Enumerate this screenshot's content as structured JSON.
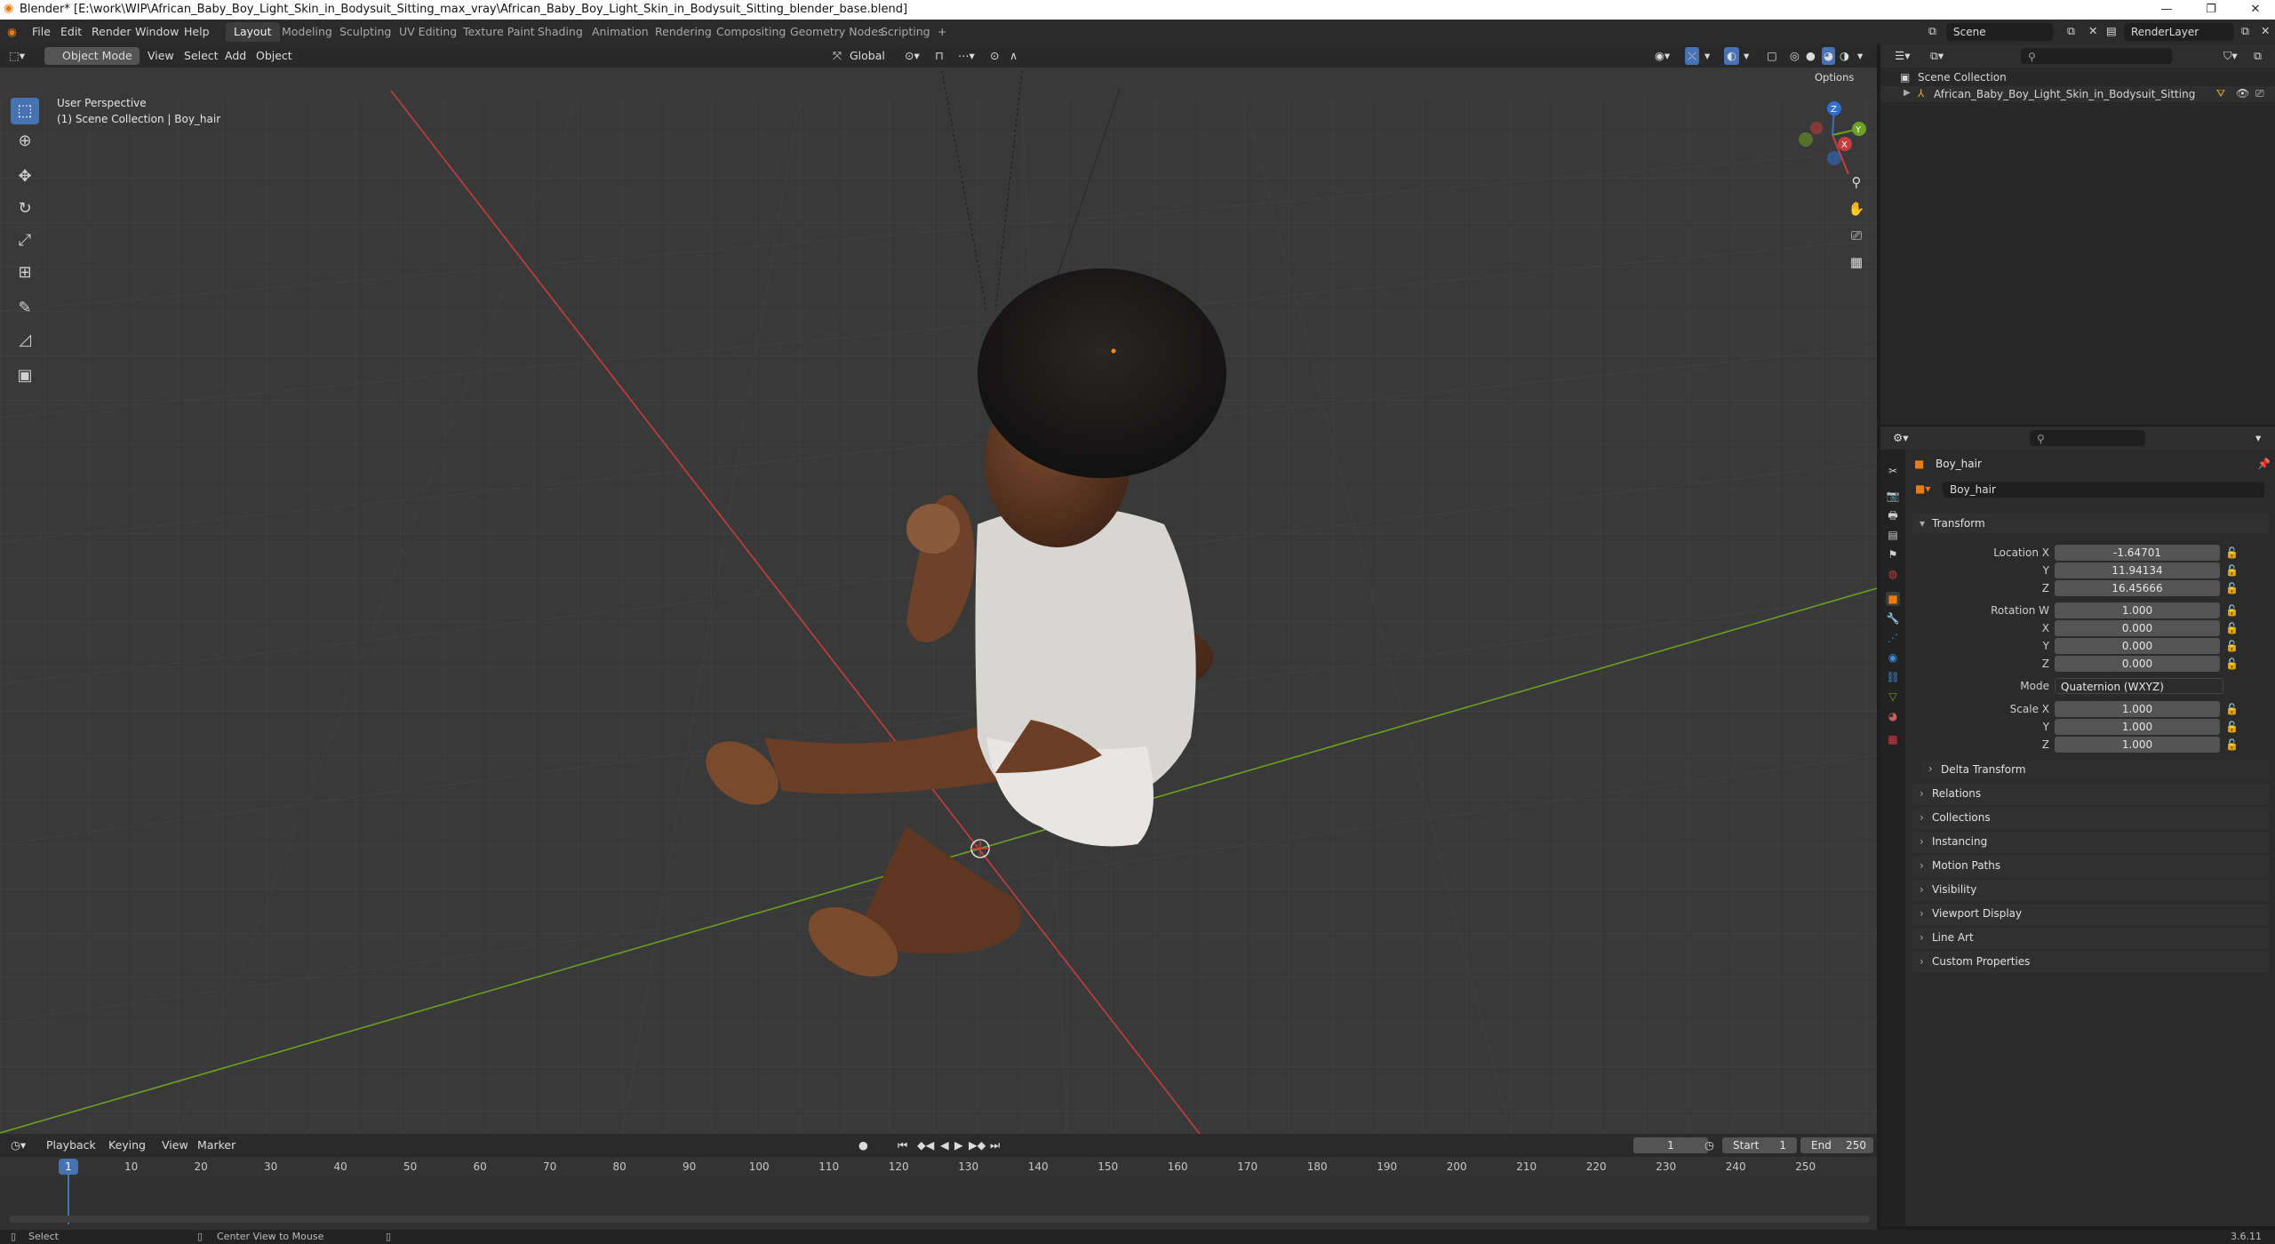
{
  "window": {
    "title": "Blender* [E:\\work\\WIP\\African_Baby_Boy_Light_Skin_in_Bodysuit_Sitting_max_vray\\African_Baby_Boy_Light_Skin_in_Bodysuit_Sitting_blender_base.blend]",
    "minimize": "—",
    "restore": "❐",
    "close": "✕"
  },
  "menu": [
    "File",
    "Edit",
    "Render",
    "Window",
    "Help"
  ],
  "workspaces": [
    "Layout",
    "Modeling",
    "Sculpting",
    "UV Editing",
    "Texture Paint",
    "Shading",
    "Animation",
    "Rendering",
    "Compositing",
    "Geometry Nodes",
    "Scripting"
  ],
  "workspace_add": "+",
  "scene": {
    "label": "Scene",
    "renderlayer": "RenderLayer"
  },
  "viewport": {
    "mode": "Object Mode",
    "menus": [
      "View",
      "Select",
      "Add",
      "Object"
    ],
    "transform_orientation": "Global",
    "options": "Options",
    "overlay_title": "User Perspective",
    "overlay_collection": "(1) Scene Collection | Boy_hair",
    "gizmo": {
      "x": "X",
      "y": "Y",
      "z": "Z"
    }
  },
  "outliner": {
    "search_placeholder": "",
    "root": "Scene Collection",
    "items": [
      {
        "name": "African_Baby_Boy_Light_Skin_in_Bodysuit_Sitting"
      }
    ]
  },
  "properties": {
    "object_name": "Boy_hair",
    "data_name": "Boy_hair",
    "transform_label": "Transform",
    "location": {
      "label": "Location X",
      "x": "-1.64701",
      "y_label": "Y",
      "y": "11.94134",
      "z_label": "Z",
      "z": "16.45666"
    },
    "rotation": {
      "label": "Rotation W",
      "w": "1.000",
      "x_label": "X",
      "x": "0.000",
      "y_label": "Y",
      "y": "0.000",
      "z_label": "Z",
      "z": "0.000"
    },
    "mode": {
      "label": "Mode",
      "value": "Quaternion (WXYZ)"
    },
    "scale": {
      "label": "Scale X",
      "x": "1.000",
      "y_label": "Y",
      "y": "1.000",
      "z_label": "Z",
      "z": "1.000"
    },
    "delta": "Delta Transform",
    "panels": [
      "Relations",
      "Collections",
      "Instancing",
      "Motion Paths",
      "Visibility",
      "Viewport Display",
      "Line Art",
      "Custom Properties"
    ]
  },
  "timeline": {
    "menus": [
      "Playback",
      "Keying",
      "View",
      "Marker"
    ],
    "current_frame": "1",
    "start_label": "Start",
    "start": "1",
    "end_label": "End",
    "end": "250",
    "ticks": [
      "1",
      "10",
      "20",
      "30",
      "40",
      "50",
      "60",
      "70",
      "80",
      "90",
      "100",
      "110",
      "120",
      "130",
      "140",
      "150",
      "160",
      "170",
      "180",
      "190",
      "200",
      "210",
      "220",
      "230",
      "240",
      "250"
    ]
  },
  "status": {
    "select": "Select",
    "center": "Center View to Mouse",
    "version": "3.6.11"
  },
  "colors": {
    "accent": "#4772b3",
    "orange": "#e87d0d",
    "x_axis": "#c83c3c",
    "y_axis": "#6ea022",
    "z_axis": "#2f6fd0"
  }
}
